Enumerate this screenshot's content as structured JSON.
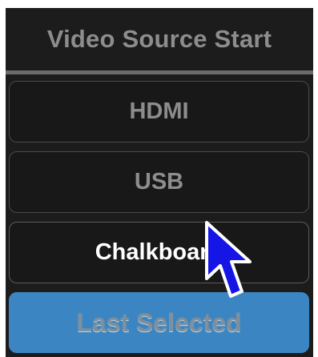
{
  "panel": {
    "title": "Video Source Start",
    "options": [
      {
        "label": "HDMI",
        "state": "unselected"
      },
      {
        "label": "USB",
        "state": "unselected"
      },
      {
        "label": "Chalkboard",
        "state": "highlighted"
      },
      {
        "label": "Last Selected",
        "state": "selected"
      }
    ]
  },
  "colors": {
    "background": "#1c1c1c",
    "inactive_text": "#8d8d8d",
    "active_text": "#ffffff",
    "selected_fill": "#3b86c2",
    "cursor": "#1515e6"
  },
  "pointer": {
    "icon": "arrow-cursor-icon"
  }
}
